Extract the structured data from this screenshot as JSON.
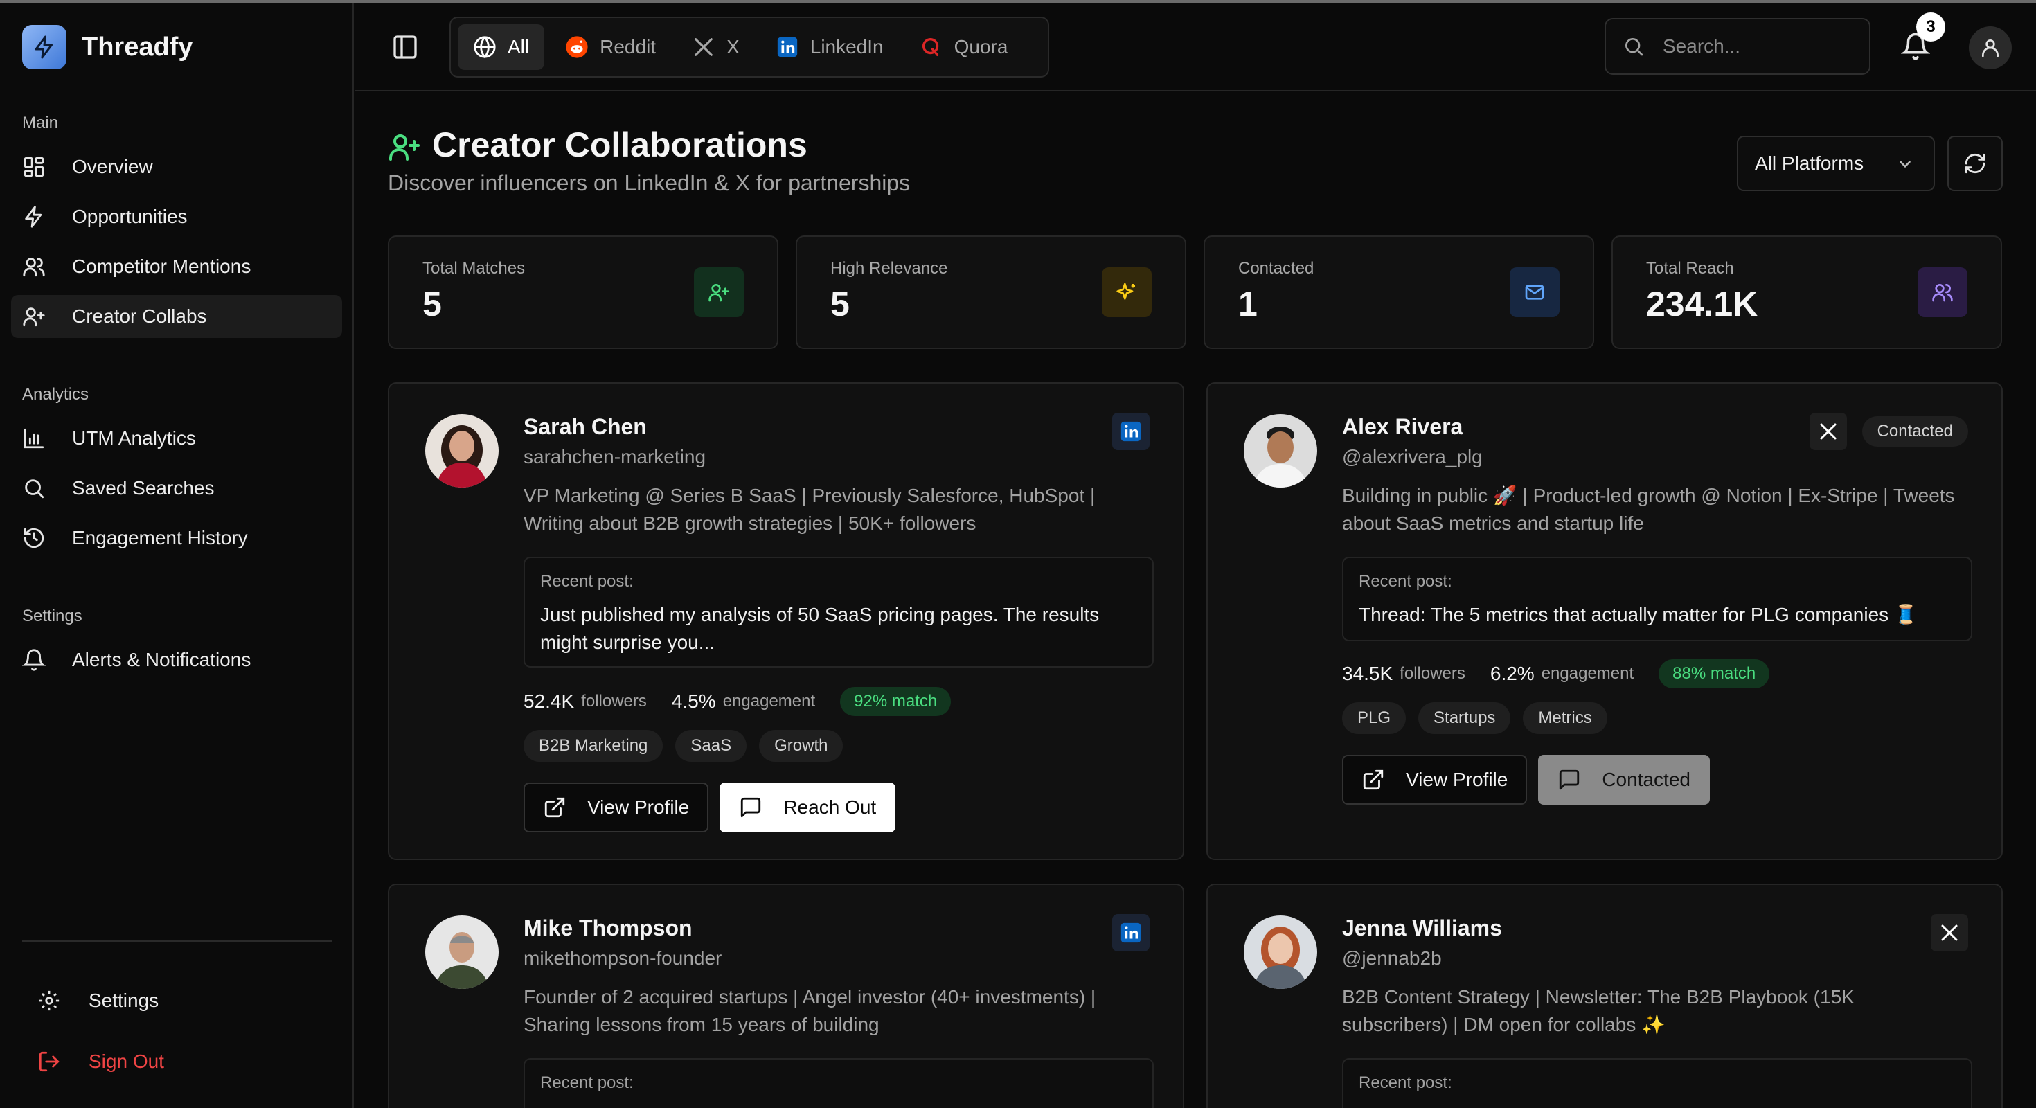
{
  "app": {
    "name": "Threadfy"
  },
  "sidebar": {
    "sections": [
      {
        "title": "Main",
        "items": [
          {
            "label": "Overview"
          },
          {
            "label": "Opportunities"
          },
          {
            "label": "Competitor Mentions"
          },
          {
            "label": "Creator Collabs"
          }
        ]
      },
      {
        "title": "Analytics",
        "items": [
          {
            "label": "UTM Analytics"
          },
          {
            "label": "Saved Searches"
          },
          {
            "label": "Engagement History"
          }
        ]
      },
      {
        "title": "Settings",
        "items": [
          {
            "label": "Alerts & Notifications"
          }
        ]
      }
    ],
    "bottom": {
      "settings": "Settings",
      "sign_out": "Sign Out"
    }
  },
  "topbar": {
    "tabs": [
      {
        "label": "All"
      },
      {
        "label": "Reddit"
      },
      {
        "label": "X"
      },
      {
        "label": "LinkedIn"
      },
      {
        "label": "Quora"
      }
    ],
    "search_placeholder": "Search...",
    "notification_count": "3"
  },
  "header": {
    "title": "Creator Collaborations",
    "subtitle": "Discover influencers on LinkedIn & X for partnerships",
    "platform_filter": "All Platforms"
  },
  "stats": [
    {
      "label": "Total Matches",
      "value": "5"
    },
    {
      "label": "High Relevance",
      "value": "5"
    },
    {
      "label": "Contacted",
      "value": "1"
    },
    {
      "label": "Total Reach",
      "value": "234.1K"
    }
  ],
  "labels": {
    "recent_post": "Recent post:",
    "followers": "followers",
    "engagement": "engagement",
    "view_profile": "View Profile",
    "reach_out": "Reach Out",
    "contacted": "Contacted"
  },
  "creators": [
    {
      "name": "Sarah Chen",
      "handle": "sarahchen-marketing",
      "bio": "VP Marketing @ Series B SaaS | Previously Salesforce, HubSpot | Writing about B2B growth strategies | 50K+ followers",
      "recent_post": "Just published my analysis of 50 SaaS pricing pages. The results might surprise you...",
      "followers": "52.4K",
      "engagement": "4.5%",
      "match": "92% match",
      "tags": [
        "B2B Marketing",
        "SaaS",
        "Growth"
      ]
    },
    {
      "name": "Alex Rivera",
      "handle": "@alexrivera_plg",
      "bio": "Building in public 🚀 | Product-led growth @ Notion | Ex-Stripe | Tweets about SaaS metrics and startup life",
      "recent_post": "Thread: The 5 metrics that actually matter for PLG companies 🧵",
      "followers": "34.5K",
      "engagement": "6.2%",
      "match": "88% match",
      "tags": [
        "PLG",
        "Startups",
        "Metrics"
      ],
      "status": "Contacted"
    },
    {
      "name": "Mike Thompson",
      "handle": "mikethompson-founder",
      "bio": "Founder of 2 acquired startups | Angel investor (40+ investments) | Sharing lessons from 15 years of building"
    },
    {
      "name": "Jenna Williams",
      "handle": "@jennab2b",
      "bio": "B2B Content Strategy | Newsletter: The B2B Playbook (15K subscribers) | DM open for collabs ✨"
    }
  ],
  "colors": {
    "accent_green": "#4ade80",
    "accent_yellow": "#facc15",
    "accent_blue": "#60a5fa",
    "accent_purple": "#a78bfa",
    "danger": "#ef4444",
    "linkedin": "#0a66c2",
    "reddit": "#ff4500"
  }
}
